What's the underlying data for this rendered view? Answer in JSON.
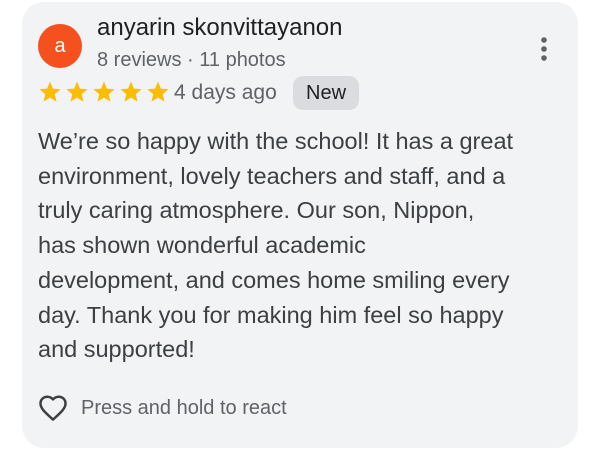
{
  "review": {
    "avatar_letter": "a",
    "author": "anyarin skonvittayanon",
    "stats": "8 reviews · 11 photos",
    "rating": 5,
    "rating_max": 5,
    "date": "4 days ago",
    "badge": "New",
    "lines": [
      "We’re so happy with the school! It has a great",
      "environment, lovely teachers and staff, and a",
      "truly caring atmosphere. Our son, Nippon,",
      "has shown wonderful academic",
      "development, and comes home smiling every",
      "day. Thank you for making him feel so happy",
      "and supported!"
    ]
  },
  "actions": {
    "react_label": "Press and hold to react",
    "react_icon": "heart-outline-icon",
    "more_icon": "more-vertical-icon"
  },
  "colors": {
    "card_background": "#f1f3f4",
    "avatar": "#f4511e",
    "star": "#fbbc04",
    "badge_background": "#dadce0"
  }
}
